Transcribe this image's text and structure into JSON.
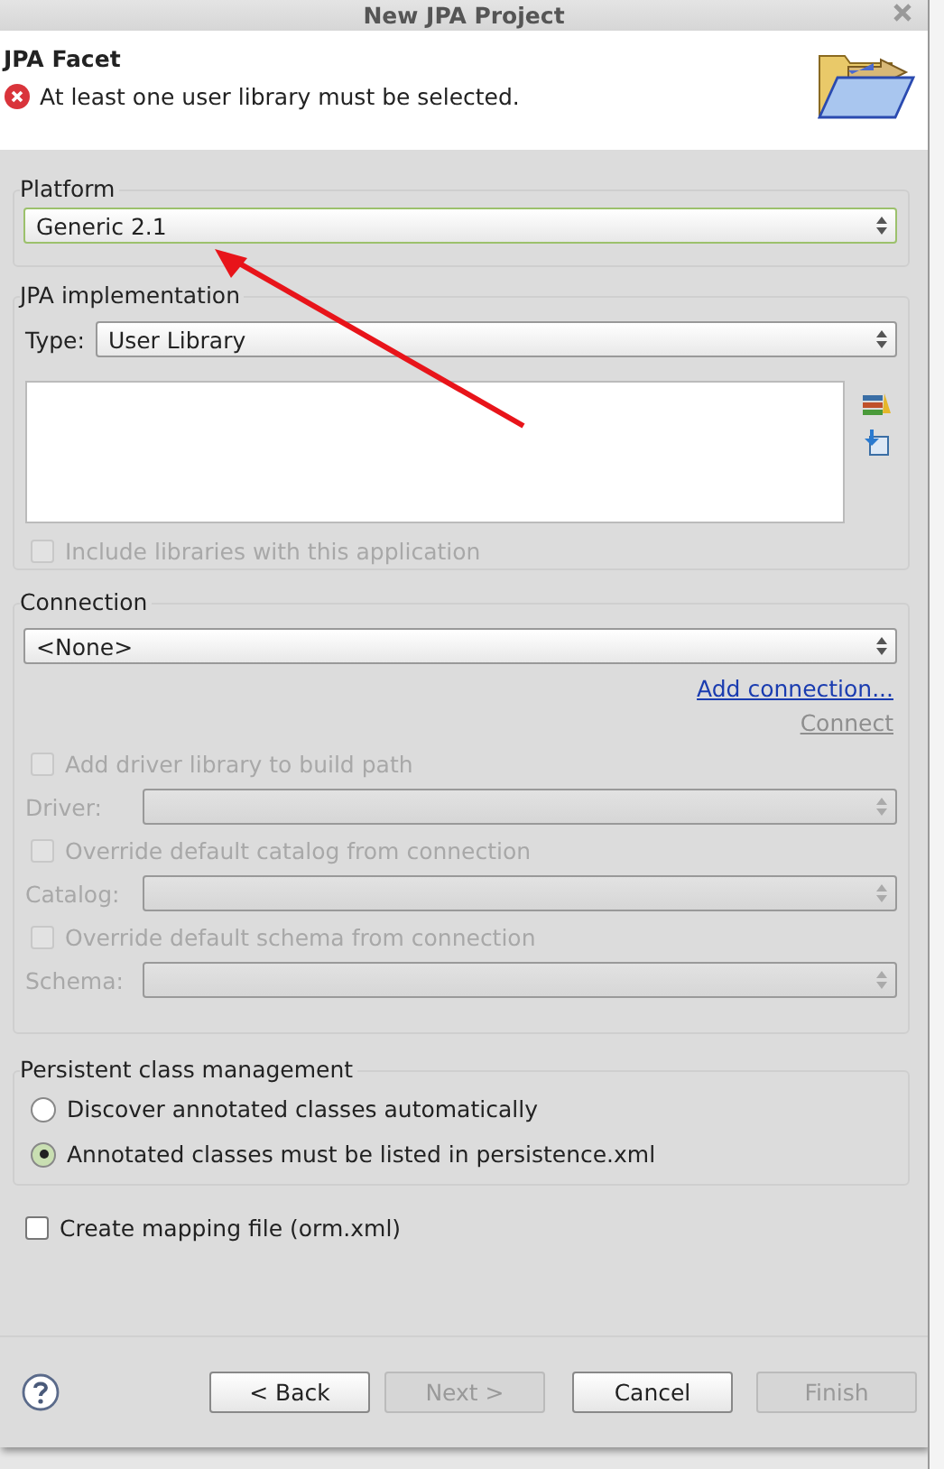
{
  "window": {
    "title": "New JPA Project"
  },
  "header": {
    "title": "JPA Facet",
    "message": "At least one user library must be selected."
  },
  "platform": {
    "label": "Platform",
    "value": "Generic 2.1",
    "focused": true
  },
  "jpa_implementation": {
    "label": "JPA implementation",
    "type_label": "Type:",
    "type_value": "User Library",
    "include_checkbox": {
      "label": "Include libraries with this application",
      "checked": false,
      "disabled": true
    }
  },
  "connection": {
    "label": "Connection",
    "value": "<None>",
    "add_link": "Add connection...",
    "connect_link": {
      "text": "Connect",
      "disabled": true
    },
    "rows": [
      {
        "kind": "checkbox",
        "label": "Add driver library to build path",
        "checked": false,
        "disabled": true
      },
      {
        "kind": "combo",
        "label": "Driver:",
        "disabled": true
      },
      {
        "kind": "checkbox",
        "label": "Override default catalog from connection",
        "checked": false,
        "disabled": true
      },
      {
        "kind": "combo",
        "label": "Catalog:",
        "disabled": true
      },
      {
        "kind": "checkbox",
        "label": "Override default schema from connection",
        "checked": false,
        "disabled": true
      },
      {
        "kind": "combo",
        "label": "Schema:",
        "disabled": true
      }
    ]
  },
  "persistent_class_management": {
    "label": "Persistent class management",
    "options": [
      {
        "label": "Discover annotated classes automatically",
        "selected": false
      },
      {
        "label": "Annotated classes must be listed in persistence.xml",
        "selected": true
      }
    ]
  },
  "mapping_file": {
    "label": "Create mapping file (orm.xml)",
    "checked": false
  },
  "buttons": [
    {
      "label": "< Back",
      "disabled": false
    },
    {
      "label": "Next >",
      "disabled": true
    },
    {
      "label": "Cancel",
      "disabled": false
    },
    {
      "label": "Finish",
      "disabled": true
    }
  ]
}
